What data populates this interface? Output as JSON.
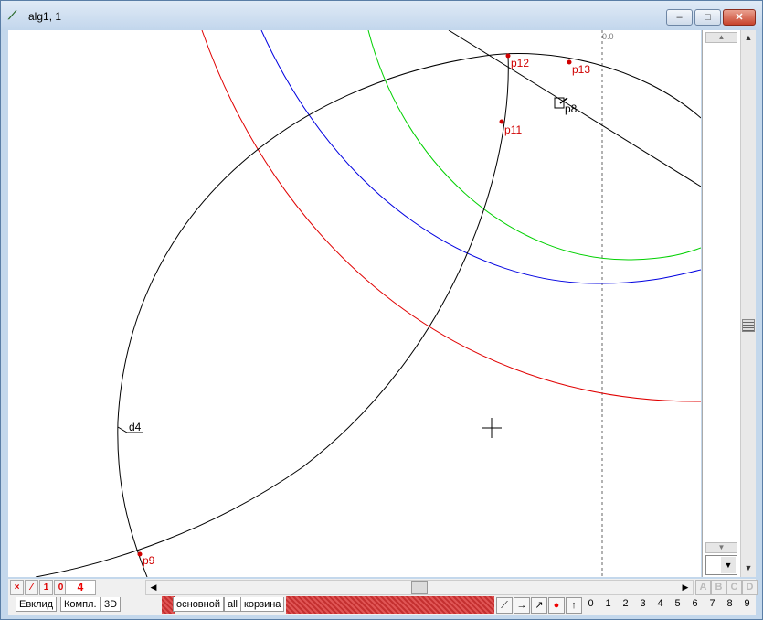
{
  "window": {
    "title": "alg1, 1",
    "app_icon": "geometry-app-icon",
    "controls": {
      "minimize": "–",
      "maximize": "□",
      "close": "✕"
    }
  },
  "canvas": {
    "axis_label": "0.0",
    "points": [
      {
        "name": "p12",
        "label": "p12"
      },
      {
        "name": "p13",
        "label": "p13"
      },
      {
        "name": "p11",
        "label": "p11"
      },
      {
        "name": "p8",
        "label": "p8"
      },
      {
        "name": "p9",
        "label": "p9"
      }
    ],
    "line_label": "d4",
    "cursor": "crosshair-icon",
    "colors": {
      "red": "#e00000",
      "blue": "#0000e0",
      "green": "#00d000",
      "black": "#000000",
      "point": "#d00000"
    }
  },
  "statusbar": {
    "buttons": [
      "×",
      "⁄",
      "1",
      "0"
    ],
    "count": "4",
    "layers": [
      "A",
      "B",
      "C",
      "D"
    ]
  },
  "tabs": {
    "left": [
      "Евклид",
      "Компл.",
      "3D"
    ],
    "middle": [
      "основной",
      "all",
      "корзина"
    ]
  },
  "toolbar": {
    "digits": [
      "0",
      "1",
      "2",
      "3",
      "4",
      "5",
      "6",
      "7",
      "8",
      "9"
    ]
  }
}
